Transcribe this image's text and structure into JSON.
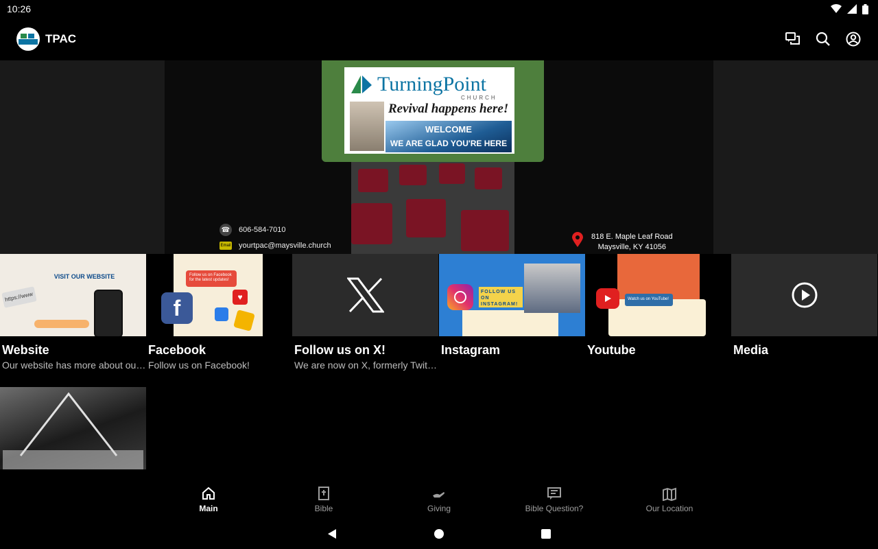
{
  "status": {
    "time": "10:26"
  },
  "app": {
    "title": "TPAC",
    "actions": [
      "chat-icon",
      "search-icon",
      "account-icon"
    ]
  },
  "hero": {
    "logo_text": "TurningPoint",
    "church_label": "CHURCH",
    "tagline": "Revival happens here!",
    "welcome_line1": "WELCOME",
    "welcome_line2": "WE ARE GLAD YOU'RE HERE",
    "phone": "606-584-7010",
    "email": "yourtpac@maysville.church",
    "address_line1": "818 E. Maple Leaf Road",
    "address_line2": "Maysville, KY 41056",
    "email_badge": "Email"
  },
  "cards": [
    {
      "title": "Website",
      "subtitle": "Our website has more about our…",
      "visit_text": "VISIT OUR WEBSITE",
      "url_hint": "https://www"
    },
    {
      "title": "Facebook",
      "subtitle": "Follow us on Facebook!",
      "bubble_text": "Follow us on Facebook for the latest updates!"
    },
    {
      "title": "Follow us on X!",
      "subtitle": "We are now on X, formerly Twitt…"
    },
    {
      "title": "Instagram",
      "subtitle": "",
      "follow_text": "FOLLOW US ON INSTAGRAM!"
    },
    {
      "title": "Youtube",
      "subtitle": "",
      "watch_text": "Watch us on YouTube!"
    },
    {
      "title": "Media",
      "subtitle": ""
    },
    {
      "title": "",
      "subtitle": ""
    }
  ],
  "nav": {
    "items": [
      {
        "label": "Main",
        "icon": "home-icon",
        "active": true
      },
      {
        "label": "Bible",
        "icon": "bible-icon",
        "active": false
      },
      {
        "label": "Giving",
        "icon": "giving-icon",
        "active": false
      },
      {
        "label": "Bible Question?",
        "icon": "message-icon",
        "active": false
      },
      {
        "label": "Our Location",
        "icon": "map-icon",
        "active": false
      }
    ]
  }
}
